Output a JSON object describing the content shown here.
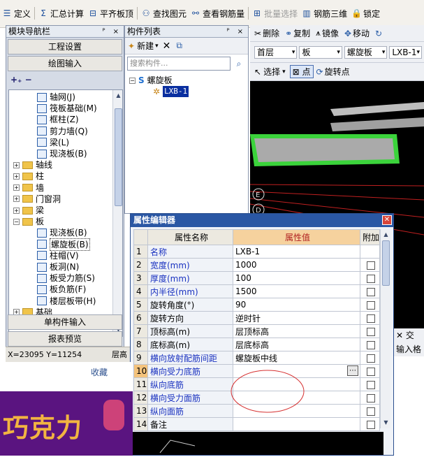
{
  "toolbar": {
    "items": [
      {
        "label": "定义",
        "icon": "define-icon"
      },
      {
        "label": "汇总计算",
        "icon": "sum-icon"
      },
      {
        "label": "平齐板顶",
        "icon": "align-icon"
      },
      {
        "label": "查找图元",
        "icon": "binoculars-icon"
      },
      {
        "label": "查看钢筋量",
        "icon": "rebar-qty-icon"
      },
      {
        "label": "批量选择",
        "icon": "batch-select-icon",
        "disabled": true
      },
      {
        "label": "钢筋三维",
        "icon": "rebar-3d-icon"
      },
      {
        "label": "锁定",
        "icon": "lock-icon"
      }
    ]
  },
  "nav": {
    "title": "模块导航栏",
    "controls": "ᴾ ×",
    "btn_project": "工程设置",
    "btn_drawing": "绘图输入",
    "tree": [
      {
        "label": "轴网(J)",
        "level": 2
      },
      {
        "label": "筏板基础(M)",
        "level": 2
      },
      {
        "label": "框柱(Z)",
        "level": 2
      },
      {
        "label": "剪力墙(Q)",
        "level": 2
      },
      {
        "label": "梁(L)",
        "level": 2
      },
      {
        "label": "现浇板(B)",
        "level": 2
      },
      {
        "label": "轴线",
        "level": 1
      },
      {
        "label": "柱",
        "level": 1
      },
      {
        "label": "墙",
        "level": 1
      },
      {
        "label": "门窗洞",
        "level": 1
      },
      {
        "label": "梁",
        "level": 1
      },
      {
        "label": "板",
        "level": 1,
        "expanded": true
      },
      {
        "label": "现浇板(B)",
        "level": 2
      },
      {
        "label": "螺旋板(B)",
        "level": 2,
        "selected": true
      },
      {
        "label": "柱帽(V)",
        "level": 2
      },
      {
        "label": "板洞(N)",
        "level": 2
      },
      {
        "label": "板受力筋(S)",
        "level": 2
      },
      {
        "label": "板负筋(F)",
        "level": 2
      },
      {
        "label": "楼层板带(H)",
        "level": 2
      },
      {
        "label": "基础",
        "level": 1
      }
    ],
    "btn_single": "单构件输入",
    "btn_report": "报表预览"
  },
  "status": {
    "coords": "X=23095 Y=11254",
    "floor": "层高"
  },
  "complist": {
    "title": "构件列表",
    "new_label": "新建",
    "search_placeholder": "搜索构件...",
    "tree_root": "螺旋板",
    "tree_child": "LXB-1"
  },
  "view": {
    "delete_label": "删除",
    "copy_label": "复制",
    "mirror_label": "镜像",
    "move_label": "移动",
    "floor": "首层",
    "type": "板",
    "subtype": "螺旋板",
    "element": "LXB-1",
    "select_label": "选择",
    "point_label": "点",
    "rotate_label": "旋转点",
    "cross_label": "交",
    "input_label": "输入格"
  },
  "props": {
    "title": "属性编辑器",
    "col_name": "属性名称",
    "col_value": "属性值",
    "col_add": "附加",
    "rows": [
      {
        "n": "1",
        "name": "名称",
        "value": "LXB-1",
        "blue": true
      },
      {
        "n": "2",
        "name": "宽度(mm)",
        "value": "1000",
        "blue": true,
        "check": true
      },
      {
        "n": "3",
        "name": "厚度(mm)",
        "value": "100",
        "blue": true,
        "check": true
      },
      {
        "n": "4",
        "name": "内半径(mm)",
        "value": "1500",
        "blue": true,
        "check": true
      },
      {
        "n": "5",
        "name": "旋转角度(°)",
        "value": "90",
        "check": true
      },
      {
        "n": "6",
        "name": "旋转方向",
        "value": "逆时针",
        "check": true
      },
      {
        "n": "7",
        "name": "顶标高(m)",
        "value": "层顶标高",
        "check": true
      },
      {
        "n": "8",
        "name": "底标高(m)",
        "value": "层底标高",
        "check": true
      },
      {
        "n": "9",
        "name": "横向放射配筋间距",
        "value": "螺旋板中线",
        "blue": true,
        "check": true
      },
      {
        "n": "10",
        "name": "横向受力底筋",
        "value": "",
        "blue": true,
        "check": true,
        "selected": true
      },
      {
        "n": "11",
        "name": "纵向底筋",
        "value": "",
        "blue": true,
        "check": true
      },
      {
        "n": "12",
        "name": "横向受力面筋",
        "value": "",
        "blue": true,
        "check": true
      },
      {
        "n": "13",
        "name": "纵向面筋",
        "value": "",
        "blue": true,
        "check": true
      },
      {
        "n": "14",
        "name": "备注",
        "value": "",
        "check": true
      }
    ]
  },
  "shop": {
    "label": "收藏"
  },
  "promo": {
    "text": "巧克力"
  }
}
